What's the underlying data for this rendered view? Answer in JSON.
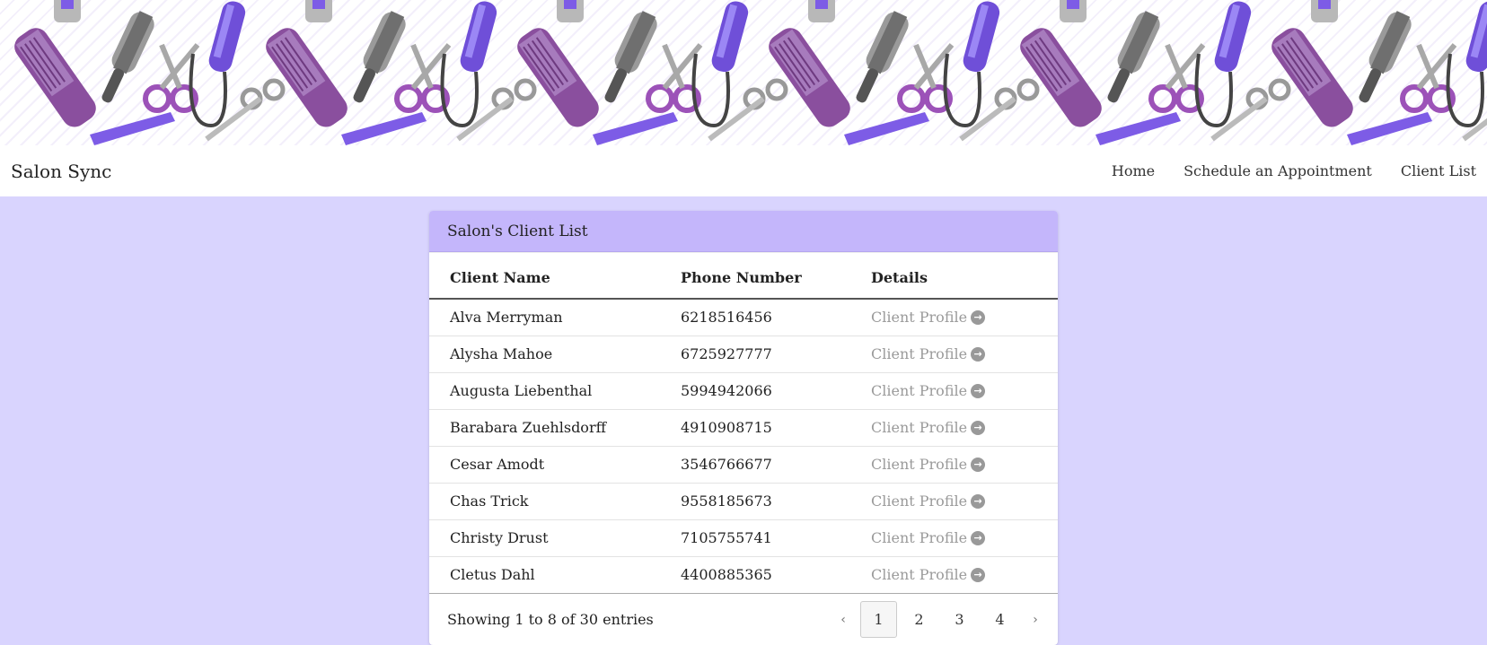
{
  "navbar": {
    "brand": "Salon Sync",
    "links": [
      "Home",
      "Schedule an Appointment",
      "Client List"
    ]
  },
  "card": {
    "title": "Salon's Client List",
    "columns": [
      "Client Name",
      "Phone Number",
      "Details"
    ],
    "rows": [
      {
        "name": "Alva Merryman",
        "phone": "6218516456",
        "details": "Client Profile"
      },
      {
        "name": "Alysha Mahoe",
        "phone": "6725927777",
        "details": "Client Profile"
      },
      {
        "name": "Augusta Liebenthal",
        "phone": "5994942066",
        "details": "Client Profile"
      },
      {
        "name": "Barabara Zuehlsdorff",
        "phone": "4910908715",
        "details": "Client Profile"
      },
      {
        "name": "Cesar Amodt",
        "phone": "3546766677",
        "details": "Client Profile"
      },
      {
        "name": "Chas Trick",
        "phone": "9558185673",
        "details": "Client Profile"
      },
      {
        "name": "Christy Drust",
        "phone": "7105755741",
        "details": "Client Profile"
      },
      {
        "name": "Cletus Dahl",
        "phone": "4400885365",
        "details": "Client Profile"
      }
    ],
    "footer": {
      "info": "Showing 1 to 8 of 30 entries",
      "prev": "‹",
      "next": "›",
      "pages": [
        "1",
        "2",
        "3",
        "4"
      ],
      "current_page": "1"
    }
  },
  "colors": {
    "page_background": "#d9d4fe",
    "card_header": "#c4b6fb",
    "banner_purple": "#8a4f9e",
    "banner_violet": "#6f4fd8"
  },
  "icons": {
    "profile_link_icon": "arrow-circle-right-icon"
  }
}
